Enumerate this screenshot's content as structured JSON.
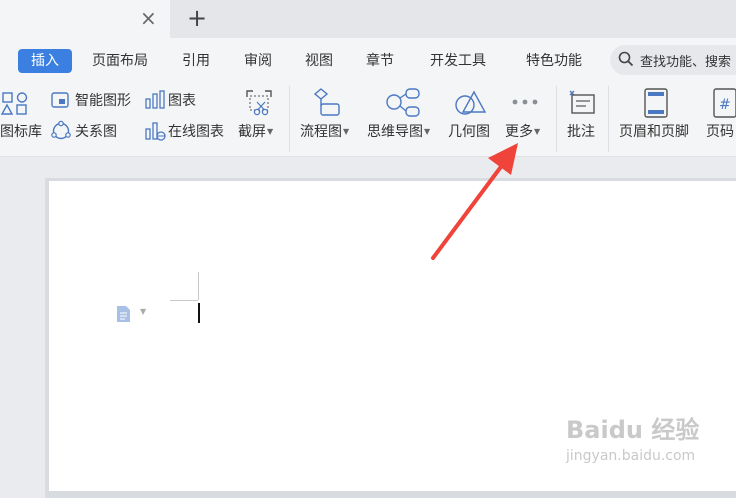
{
  "tabs": {
    "close_glyph": "×",
    "new_glyph": "+"
  },
  "menu": {
    "items": [
      "插入",
      "页面布局",
      "引用",
      "审阅",
      "视图",
      "章节",
      "开发工具",
      "特色功能"
    ],
    "active": "插入",
    "search_placeholder": "查找功能、搜索"
  },
  "ribbon": {
    "icon_library": "图标库",
    "smart_graphic": "智能图形",
    "chart": "图表",
    "relationship": "关系图",
    "online_chart": "在线图表",
    "screenshot": "截屏",
    "flowchart": "流程图",
    "mindmap": "思维导图",
    "geometry": "几何图",
    "more": "更多",
    "comment": "批注",
    "header_footer": "页眉和页脚",
    "page_number": "页码"
  },
  "watermark": {
    "logo": "Baidu 经验",
    "url": "jingyan.baidu.com"
  },
  "colors": {
    "accent": "#3b7fe0",
    "icon_blue": "#4a78c2",
    "arrow": "#f0433a"
  }
}
